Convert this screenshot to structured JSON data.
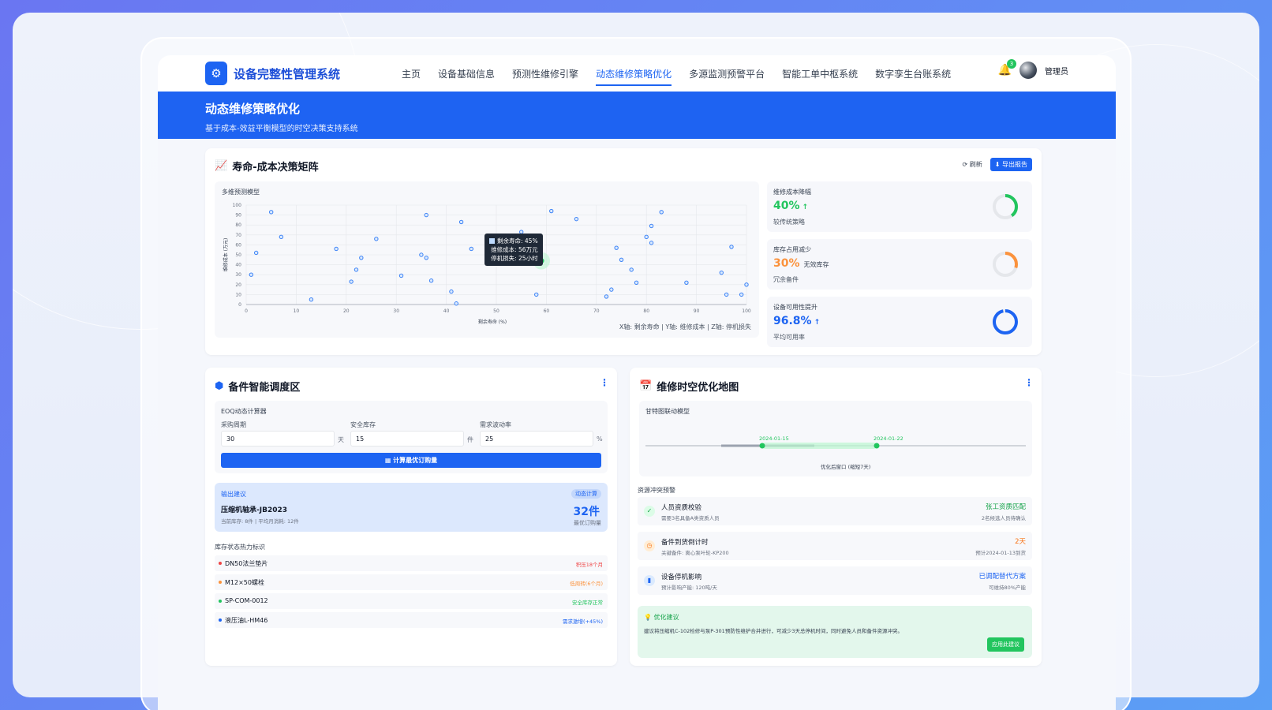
{
  "app": {
    "title": "设备完整性管理系统",
    "nav": [
      "主页",
      "设备基础信息",
      "预测性维修引擎",
      "动态维修策略优化",
      "多源监测预警平台",
      "智能工单中枢系统",
      "数字孪生台账系统"
    ],
    "active_nav": "动态维修策略优化",
    "notifications": "3",
    "user": "管理员"
  },
  "banner": {
    "title": "动态维修策略优化",
    "subtitle": "基于成本-效益平衡模型的时空决策支持系统"
  },
  "matrix": {
    "title": "寿命-成本决策矩阵",
    "refresh": "刷新",
    "export": "导出报告",
    "plot_title": "多维预测模型",
    "axes_note": "X轴: 剩余寿命 | Y轴: 维修成本 | Z轴: 停机损失",
    "tooltip": {
      "life": "剩余寿命: 45%",
      "cost": "维修成本: 56万元",
      "loss": "停机损失: 25小时"
    }
  },
  "chart_data": {
    "type": "scatter",
    "title": "多维预测模型",
    "xlabel": "剩余寿命 (%)",
    "ylabel": "维修成本 (万元)",
    "xlim": [
      0,
      100
    ],
    "ylim": [
      0,
      100
    ],
    "x_ticks": [
      "0",
      "10",
      "20",
      "30",
      "40",
      "50",
      "60",
      "70",
      "80",
      "90",
      "100"
    ],
    "y_ticks": [
      "0",
      "10",
      "20",
      "30",
      "40",
      "50",
      "60",
      "70",
      "80",
      "90",
      "100"
    ],
    "grid": true,
    "x": [
      1,
      2,
      5,
      7,
      13,
      18,
      21,
      22,
      23,
      26,
      31,
      35,
      36,
      36,
      37,
      41,
      42,
      43,
      45,
      55,
      58,
      61,
      66,
      72,
      73,
      74,
      75,
      77,
      78,
      80,
      81,
      81,
      83,
      88,
      95,
      96,
      97,
      99,
      100
    ],
    "y": [
      30,
      52,
      93,
      68,
      5,
      56,
      23,
      35,
      47,
      66,
      29,
      50,
      90,
      47,
      24,
      13,
      1,
      83,
      56,
      73,
      10,
      94,
      86,
      8,
      15,
      57,
      45,
      35,
      22,
      68,
      62,
      79,
      93,
      22,
      32,
      10,
      58,
      10,
      20
    ],
    "highlight": {
      "x": 59,
      "y": 44
    }
  },
  "kpis": [
    {
      "label": "维修成本降幅",
      "value": "40%",
      "suffix": "",
      "sub": "较传统策略",
      "color": "#22c55e",
      "ring": 0.4,
      "arrow": "↑"
    },
    {
      "label": "库存占用减少",
      "value": "30%",
      "suffix": "无效库存",
      "sub": "冗余备件",
      "color": "#fb923c",
      "ring": 0.3,
      "arrow": ""
    },
    {
      "label": "设备可用性提升",
      "value": "96.8%",
      "suffix": "",
      "sub": "平均可用率",
      "color": "#1d64f2",
      "ring": 0.968,
      "arrow": "↑"
    }
  ],
  "spare": {
    "title": "备件智能调度区",
    "eoq_title": "EOQ动态计算器",
    "fields": [
      {
        "label": "采购周期",
        "value": "30",
        "unit": "天"
      },
      {
        "label": "安全库存",
        "value": "15",
        "unit": "件"
      },
      {
        "label": "需求波动率",
        "value": "25",
        "unit": "%"
      }
    ],
    "calc_button": "计算最优订购量",
    "advice": {
      "label": "输出建议",
      "tag": "动态计算",
      "part": "压缩机轴承-JB2023",
      "detail": "当前库存: 8件 | 平均月消耗: 12件",
      "qty": "32件",
      "qty_label": "最优订购量"
    },
    "heat_title": "库存状态热力标识",
    "heat": [
      {
        "name": "DN50法兰垫片",
        "status": "积压18个月",
        "color": "#ef4444"
      },
      {
        "name": "M12×50螺栓",
        "status": "低周转(6个月)",
        "color": "#fb923c"
      },
      {
        "name": "SP-COM-0012",
        "status": "安全库存正常",
        "color": "#22c55e"
      },
      {
        "name": "液压油L-HM46",
        "status": "需求激增(+45%)",
        "color": "#1d64f2"
      }
    ]
  },
  "map": {
    "title": "维修时空优化地图",
    "gantt_title": "甘特图联动模型",
    "date1": "2024-01-15",
    "date2": "2024-01-22",
    "window_label": "优化后窗口 (缩短7天)",
    "resource_title": "资源冲突预警",
    "resources": [
      {
        "name": "人员资质校验",
        "desc": "需要3名具备A类资质人员",
        "right": "张工资质匹配",
        "right_sub": "2名候选人员待确认",
        "color": "#16a34a",
        "icon": "✓",
        "icon_bg": "#dcfce7"
      },
      {
        "name": "备件到货倒计时",
        "desc": "关键备件: 离心泵叶轮-KP200",
        "right": "2天",
        "right_sub": "预计2024-01-13到货",
        "color": "#f97316",
        "icon": "◷",
        "icon_bg": "#ffedd5"
      },
      {
        "name": "设备停机影响",
        "desc": "预计影响产能: 120吨/天",
        "right": "已调配替代方案",
        "right_sub": "可维持80%产能",
        "color": "#1d64f2",
        "icon": "▮",
        "icon_bg": "#dbeafe"
      }
    ],
    "optimize": {
      "title": "优化建议",
      "body": "建议将压缩机C-102检修与泵P-301预防性维护合并进行，可减少3天总停机时间，同时避免人员和备件资源冲突。",
      "button": "应用此建议"
    }
  }
}
